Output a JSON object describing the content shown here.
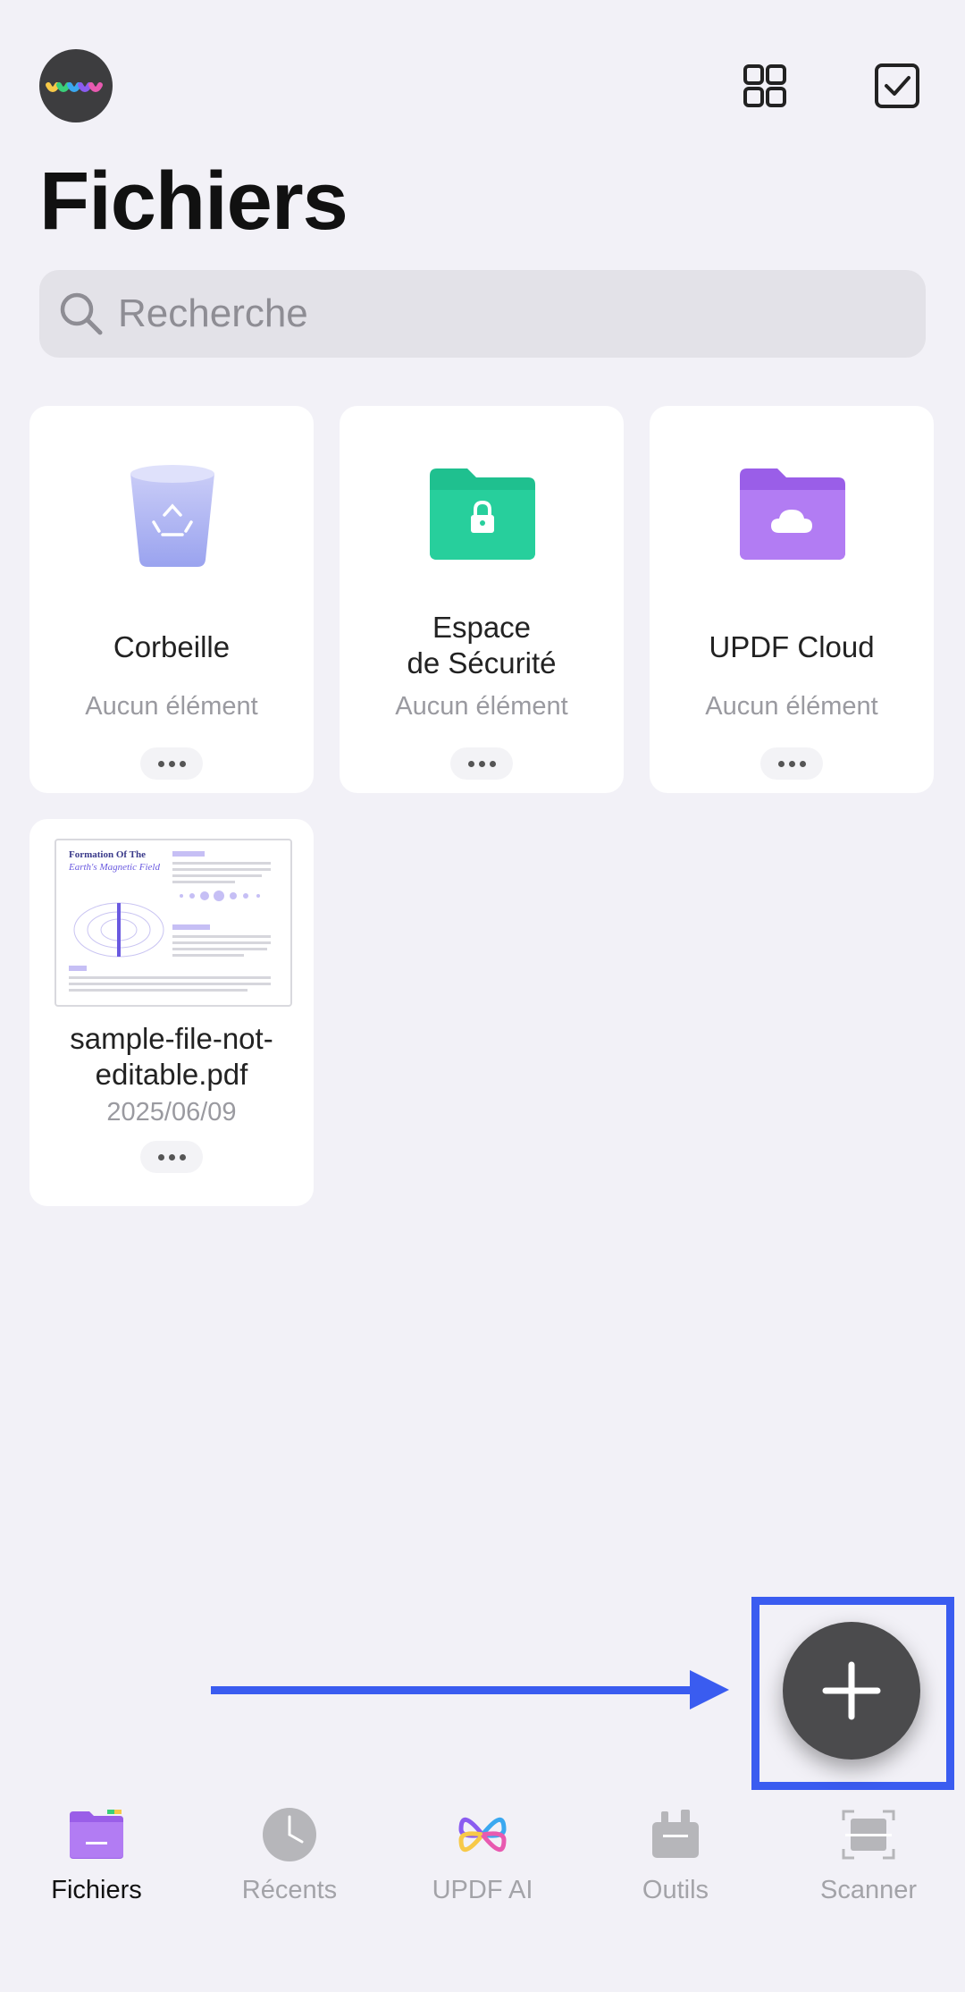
{
  "header": {
    "title": "Fichiers",
    "grid_view_icon": "grid-icon",
    "select_icon": "checkbox-icon"
  },
  "search": {
    "placeholder": "Recherche"
  },
  "folders": [
    {
      "title": "Corbeille",
      "subtitle": "Aucun élément",
      "icon": "trash-icon"
    },
    {
      "title_line1": "Espace",
      "title_line2": "de Sécurité",
      "subtitle": "Aucun élément",
      "icon": "locked-folder-icon"
    },
    {
      "title": "UPDF Cloud",
      "subtitle": "Aucun élément",
      "icon": "cloud-folder-icon"
    }
  ],
  "files": [
    {
      "name_line1": "sample-file-not-",
      "name_line2": "editable.pdf",
      "date": "2025/06/09",
      "thumb_title_1": "Formation Of The",
      "thumb_title_2": "Earth's Magnetic Field"
    }
  ],
  "tabbar": [
    {
      "label": "Fichiers",
      "icon": "folder-icon",
      "active": true
    },
    {
      "label": "Récents",
      "icon": "clock-icon",
      "active": false
    },
    {
      "label": "UPDF AI",
      "icon": "ai-icon",
      "active": false
    },
    {
      "label": "Outils",
      "icon": "toolbox-icon",
      "active": false
    },
    {
      "label": "Scanner",
      "icon": "scanner-icon",
      "active": false
    }
  ],
  "colors": {
    "background": "#f2f1f7",
    "annotation_blue": "#3a5cf0",
    "fab": "#4b4b4d",
    "secure_green": "#1fc08f",
    "cloud_purple": "#a56cf0"
  }
}
